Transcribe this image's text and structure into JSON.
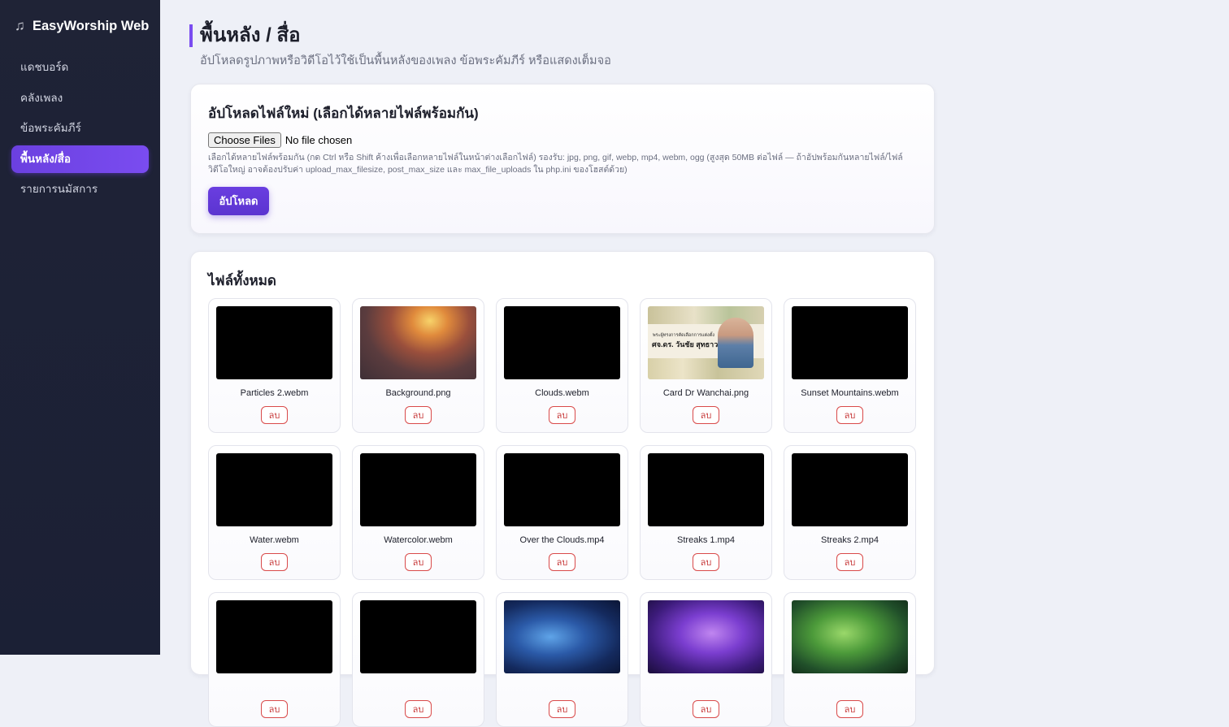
{
  "brand": {
    "icon": "music-note-icon",
    "icon_glyph": "♫",
    "title": "EasyWorship Web"
  },
  "nav": {
    "items": [
      {
        "label": "แดชบอร์ด",
        "active": false
      },
      {
        "label": "คลังเพลง",
        "active": false
      },
      {
        "label": "ข้อพระคัมภีร์",
        "active": false
      },
      {
        "label": "พื้นหลัง/สื่อ",
        "active": true
      },
      {
        "label": "รายการนมัสการ",
        "active": false
      }
    ]
  },
  "page": {
    "title": "พื้นหลัง / สื่อ",
    "subtitle": "อัปโหลดรูปภาพหรือวิดีโอไว้ใช้เป็นพื้นหลังของเพลง ข้อพระคัมภีร์ หรือแสดงเต็มจอ"
  },
  "upload": {
    "title": "อัปโหลดไฟล์ใหม่ (เลือกได้หลายไฟล์พร้อมกัน)",
    "choose_label": "Choose Files",
    "no_file_text": "No file chosen",
    "hint": "เลือกได้หลายไฟล์พร้อมกัน (กด Ctrl หรือ Shift ค้างเพื่อเลือกหลายไฟล์ในหน้าต่างเลือกไฟล์) รองรับ: jpg, png, gif, webp, mp4, webm, ogg (สูงสุด 50MB ต่อไฟล์ — ถ้าอัปพร้อมกันหลายไฟล์/ไฟล์วิดีโอใหญ่ อาจต้องปรับค่า upload_max_filesize, post_max_size และ max_file_uploads ใน php.ini ของโฮสต์ด้วย)",
    "button_label": "อัปโหลด",
    "accent": "#6a3ee0"
  },
  "files": {
    "title": "ไฟล์ทั้งหมด",
    "delete_label": "ลบ",
    "items": [
      {
        "name": "Particles 2.webm",
        "thumb": "black"
      },
      {
        "name": "Background.png",
        "thumb": "sunset"
      },
      {
        "name": "Clouds.webm",
        "thumb": "black"
      },
      {
        "name": "Card Dr Wanchai.png",
        "thumb": "card-photo",
        "card_line1": "พระผู้ทรงการคัดเลือกการแต่งตั้ง",
        "card_line2": "ศจ.ดร. วันชัย สุทธาวาส"
      },
      {
        "name": "Sunset Mountains.webm",
        "thumb": "black"
      },
      {
        "name": "Water.webm",
        "thumb": "black"
      },
      {
        "name": "Watercolor.webm",
        "thumb": "black"
      },
      {
        "name": "Over the Clouds.mp4",
        "thumb": "black"
      },
      {
        "name": "Streaks 1.mp4",
        "thumb": "black"
      },
      {
        "name": "Streaks 2.mp4",
        "thumb": "black"
      },
      {
        "name": "",
        "thumb": "black"
      },
      {
        "name": "",
        "thumb": "black"
      },
      {
        "name": "",
        "thumb": "galaxy-blue"
      },
      {
        "name": "",
        "thumb": "galaxy-purple"
      },
      {
        "name": "",
        "thumb": "galaxy-green"
      }
    ]
  }
}
